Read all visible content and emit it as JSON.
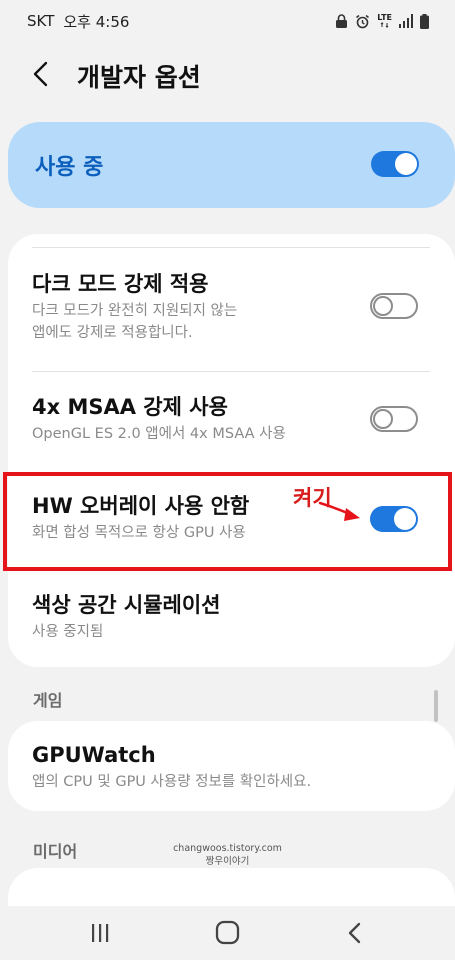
{
  "status_bar": {
    "carrier": "SKT",
    "time": "오후 4:56",
    "network": "LTE",
    "icons": [
      "alarm-icon",
      "lock-icon",
      "lte-icon",
      "signal-icon",
      "battery-icon"
    ]
  },
  "header": {
    "title": "개발자 옵션",
    "back_icon": "chevron-left-icon"
  },
  "master": {
    "label": "사용 중",
    "state": "on"
  },
  "settings": [
    {
      "title": "다크 모드 강제 적용",
      "summary_lines": [
        "다크 모드가 완전히 지원되지 않는",
        "앱에도 강제로 적용합니다."
      ],
      "toggle": "off"
    },
    {
      "title": "4x MSAA 강제 사용",
      "summary_lines": [
        "OpenGL ES 2.0 앱에서 4x MSAA 사용"
      ],
      "toggle": "off"
    },
    {
      "title": "HW 오버레이 사용 안함",
      "summary_lines": [
        "화면 합성 목적으로 항상 GPU 사용"
      ],
      "toggle": "on"
    },
    {
      "title": "색상 공간 시뮬레이션",
      "summary_lines": [
        "사용 중지됨"
      ]
    }
  ],
  "annotation": {
    "label": "켜기",
    "color": "#e5141b"
  },
  "section_game": {
    "header": "게임",
    "item_title": "GPUWatch",
    "item_summary": "앱의 CPU 및 GPU 사용량 정보를 확인하세요."
  },
  "section_media": {
    "header": "미디어"
  },
  "watermark": {
    "line1": "changwoos.tistory.com",
    "line2": "짱우이야기"
  },
  "navigation": {
    "recents_icon": "recents-icon",
    "home_icon": "home-icon",
    "back_icon": "back-icon"
  },
  "colors": {
    "accent": "#1e78de",
    "master_bg": "#b6dbfa",
    "master_text": "#0d5fbd",
    "annotation": "#e5141b"
  }
}
